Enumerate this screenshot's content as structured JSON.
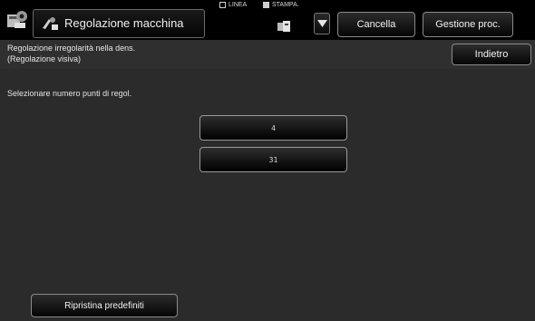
{
  "header": {
    "title": "Regolazione macchina",
    "mode_linea": "LINEA",
    "mode_stampa": "STAMPA.",
    "cancel_label": "Cancella",
    "job_label": "Gestione proc."
  },
  "subheader": {
    "line1": "Regolazione irregolarità nella dens.",
    "line2": "(Regolazione visiva)",
    "back_label": "Indietro"
  },
  "main": {
    "instruction": "Selezionare numero punti di regol.",
    "options": [
      "4",
      "31"
    ],
    "reset_label": "Ripristina predefiniti"
  }
}
